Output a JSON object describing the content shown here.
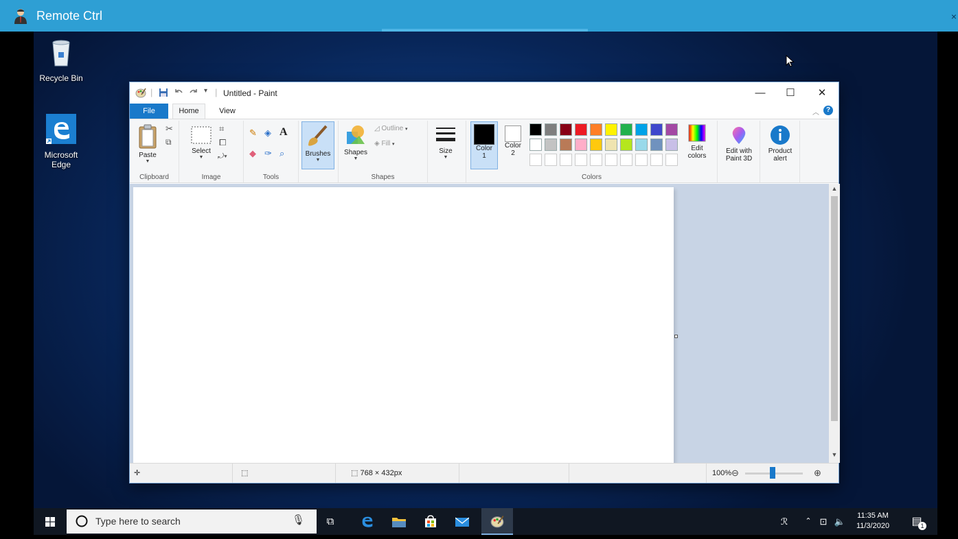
{
  "remote": {
    "title": "Remote Ctrl",
    "close_glyph": "×",
    "icon": "user-agent-icon"
  },
  "desktop": {
    "icons": [
      {
        "label": "Recycle Bin",
        "icon": "recycle-bin-icon"
      },
      {
        "label": "Microsoft Edge",
        "icon": "edge-icon"
      }
    ]
  },
  "paint": {
    "title": "Untitled - Paint",
    "tabs": {
      "file": "File",
      "home": "Home",
      "view": "View"
    },
    "window_buttons": {
      "minimize": "—",
      "maximize": "☐",
      "close": "✕"
    },
    "clipboard": {
      "paste": "Paste",
      "group": "Clipboard"
    },
    "image": {
      "select": "Select",
      "group": "Image"
    },
    "tools": {
      "group": "Tools"
    },
    "brushes": {
      "label": "Brushes"
    },
    "shapes": {
      "label": "Shapes",
      "outline": "Outline",
      "fill": "Fill",
      "group": "Shapes"
    },
    "size": {
      "label": "Size"
    },
    "colors": {
      "color1": "Color\n1",
      "color1_a": "Color",
      "color1_b": "1",
      "color2_a": "Color",
      "color2_b": "2",
      "edit_colors_a": "Edit",
      "edit_colors_b": "colors",
      "group": "Colors",
      "color1_value": "#000000",
      "color2_value": "#ffffff",
      "palette_row1": [
        "#000000",
        "#7f7f7f",
        "#880015",
        "#ed1c24",
        "#ff7f27",
        "#fff200",
        "#22b14c",
        "#00a2e8",
        "#3f48cc",
        "#a349a4"
      ],
      "palette_row2": [
        "#ffffff",
        "#c3c3c3",
        "#b97a57",
        "#ffaec9",
        "#ffc90e",
        "#efe4b0",
        "#b5e61d",
        "#99d9ea",
        "#7092be",
        "#c8bfe7"
      ]
    },
    "paint3d": {
      "a": "Edit with",
      "b": "Paint 3D"
    },
    "product_alert": {
      "a": "Product",
      "b": "alert"
    },
    "status": {
      "dimensions": "768 × 432px",
      "zoom": "100%"
    }
  },
  "taskbar": {
    "search_placeholder": "Type here to search",
    "time": "11:35 AM",
    "date": "11/3/2020",
    "notification_count": "1"
  }
}
